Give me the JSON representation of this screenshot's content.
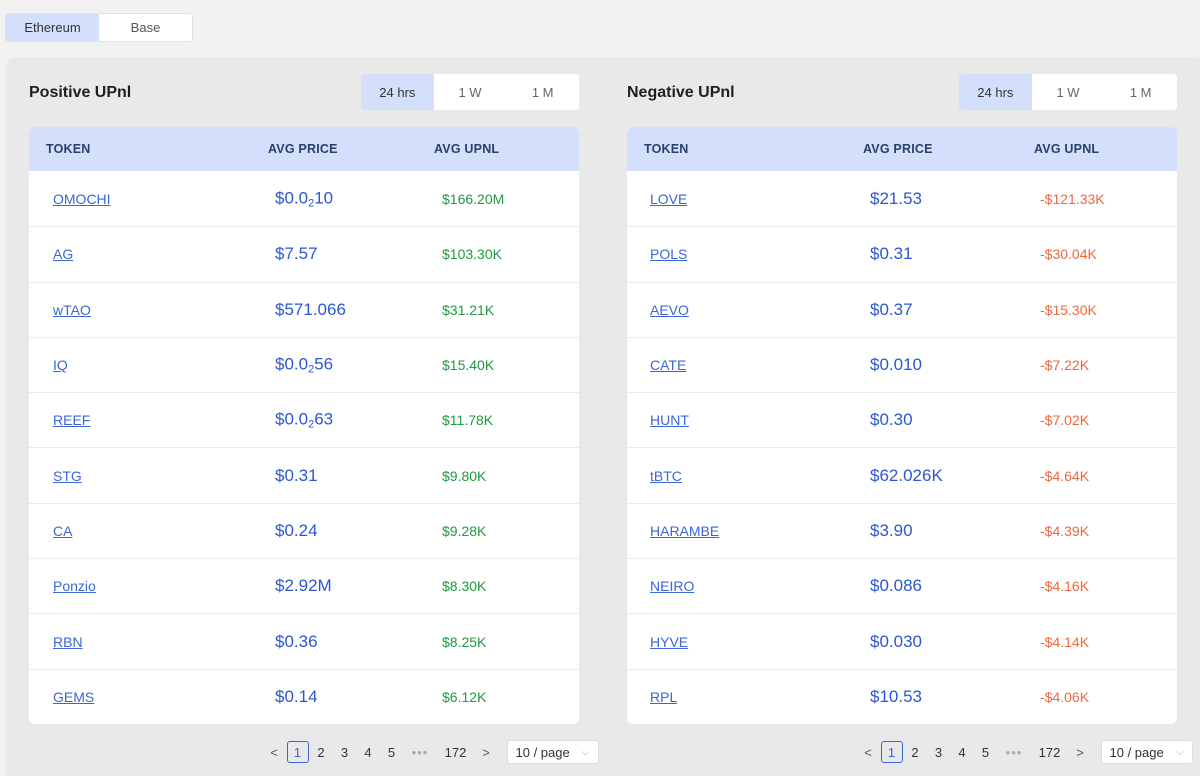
{
  "chains": [
    {
      "label": "Ethereum",
      "active": true
    },
    {
      "label": "Base",
      "active": false
    }
  ],
  "periods": [
    "24 hrs",
    "1 W",
    "1 M"
  ],
  "columns": {
    "token": "TOKEN",
    "avg_price": "AVG PRICE",
    "avg_upnl": "AVG UPNL"
  },
  "positive": {
    "title": "Positive UPnl",
    "rows": [
      {
        "token": "OMOCHI",
        "price_main": "$0.0",
        "price_sub": "2",
        "price_tail": "10",
        "upnl": "$166.20M"
      },
      {
        "token": "AG",
        "price_main": "$7.57",
        "price_sub": "",
        "price_tail": "",
        "upnl": "$103.30K"
      },
      {
        "token": "wTAO",
        "price_main": "$571.066",
        "price_sub": "",
        "price_tail": "",
        "upnl": "$31.21K"
      },
      {
        "token": "IQ",
        "price_main": "$0.0",
        "price_sub": "2",
        "price_tail": "56",
        "upnl": "$15.40K"
      },
      {
        "token": "REEF",
        "price_main": "$0.0",
        "price_sub": "2",
        "price_tail": "63",
        "upnl": "$11.78K"
      },
      {
        "token": "STG",
        "price_main": "$0.31",
        "price_sub": "",
        "price_tail": "",
        "upnl": "$9.80K"
      },
      {
        "token": "CA",
        "price_main": "$0.24",
        "price_sub": "",
        "price_tail": "",
        "upnl": "$9.28K"
      },
      {
        "token": "Ponzio",
        "price_main": "$2.92M",
        "price_sub": "",
        "price_tail": "",
        "upnl": "$8.30K"
      },
      {
        "token": "RBN",
        "price_main": "$0.36",
        "price_sub": "",
        "price_tail": "",
        "upnl": "$8.25K"
      },
      {
        "token": "GEMS",
        "price_main": "$0.14",
        "price_sub": "",
        "price_tail": "",
        "upnl": "$6.12K"
      }
    ]
  },
  "negative": {
    "title": "Negative UPnl",
    "rows": [
      {
        "token": "LOVE",
        "price_main": "$21.53",
        "price_sub": "",
        "price_tail": "",
        "upnl": "-$121.33K"
      },
      {
        "token": "POLS",
        "price_main": "$0.31",
        "price_sub": "",
        "price_tail": "",
        "upnl": "-$30.04K"
      },
      {
        "token": "AEVO",
        "price_main": "$0.37",
        "price_sub": "",
        "price_tail": "",
        "upnl": "-$15.30K"
      },
      {
        "token": "CATE",
        "price_main": "$0.010",
        "price_sub": "",
        "price_tail": "",
        "upnl": "-$7.22K"
      },
      {
        "token": "HUNT",
        "price_main": "$0.30",
        "price_sub": "",
        "price_tail": "",
        "upnl": "-$7.02K"
      },
      {
        "token": "tBTC",
        "price_main": "$62.026K",
        "price_sub": "",
        "price_tail": "",
        "upnl": "-$4.64K"
      },
      {
        "token": "HARAMBE",
        "price_main": "$3.90",
        "price_sub": "",
        "price_tail": "",
        "upnl": "-$4.39K"
      },
      {
        "token": "NEIRO",
        "price_main": "$0.086",
        "price_sub": "",
        "price_tail": "",
        "upnl": "-$4.16K"
      },
      {
        "token": "HYVE",
        "price_main": "$0.030",
        "price_sub": "",
        "price_tail": "",
        "upnl": "-$4.14K"
      },
      {
        "token": "RPL",
        "price_main": "$10.53",
        "price_sub": "",
        "price_tail": "",
        "upnl": "-$4.06K"
      }
    ]
  },
  "pagination": {
    "prev": "<",
    "next": ">",
    "pages": [
      "1",
      "2",
      "3",
      "4",
      "5"
    ],
    "ellipsis": "•••",
    "last_page": "172",
    "current_page": "1",
    "page_size": "10 / page"
  },
  "colors": {
    "accent": "#d4e0fb",
    "link": "#3a66d6",
    "positive": "#1f9a3f",
    "negative": "#f2663d"
  }
}
